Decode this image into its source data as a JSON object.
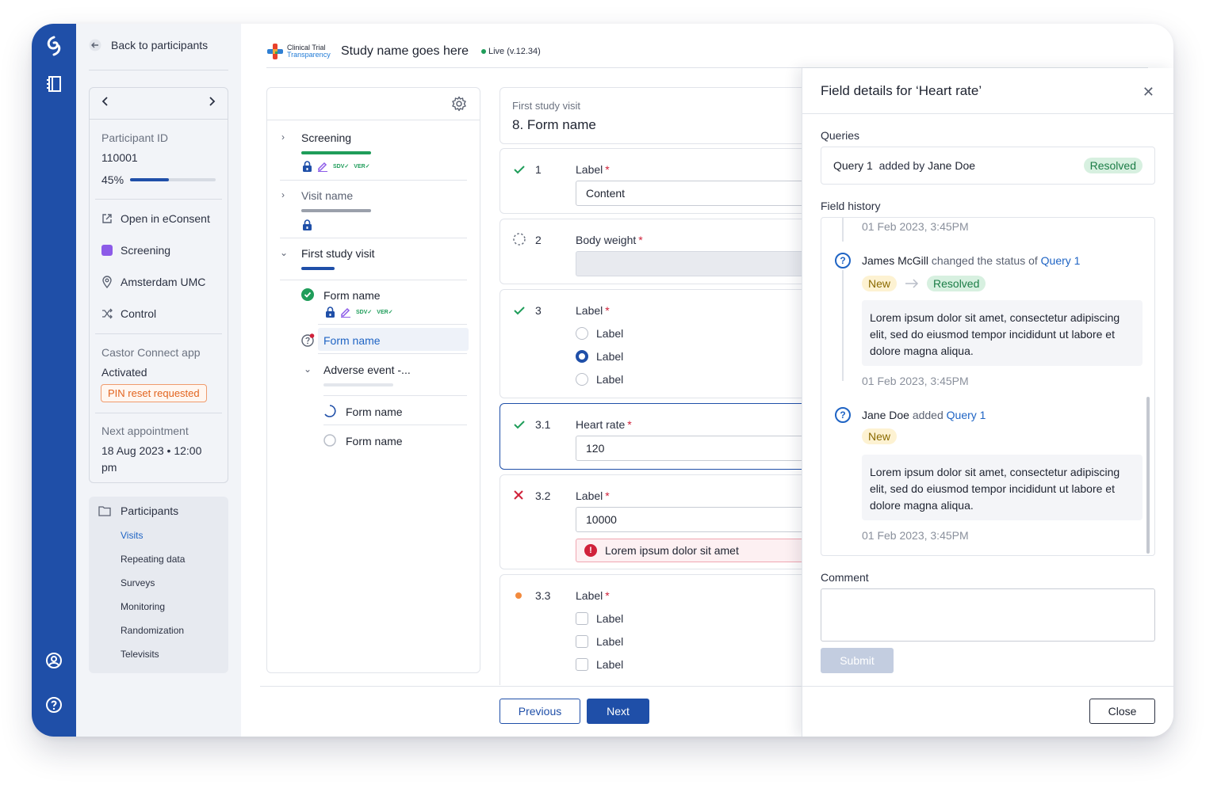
{
  "sidebar": {
    "back_label": "Back to participants",
    "participant_id_label": "Participant ID",
    "participant_id": "110001",
    "progress_text": "45%",
    "progress": 0.45,
    "links": [
      "Open in eConsent",
      "Screening",
      "Amsterdam UMC",
      "Control"
    ],
    "screening_color": "#8c5be8",
    "connect_label": "Castor Connect app",
    "connect_status": "Activated",
    "pin_badge": "PIN reset requested",
    "next_label": "Next appointment",
    "next_value_1": "18 Aug 2023 • 12:00",
    "next_value_2": "pm",
    "nav_head": "Participants",
    "nav_items": [
      "Visits",
      "Repeating data",
      "Surveys",
      "Monitoring",
      "Randomization",
      "Televisits"
    ]
  },
  "topbar": {
    "logo_line1": "Clinical Trial",
    "logo_line2": "Transparency",
    "study_name": "Study name goes here",
    "live": "Live (v.12.34)"
  },
  "tree": {
    "screening": "Screening",
    "visit_name": "Visit name",
    "first_visit": "First study visit",
    "form1": "Form name",
    "form2": "Form name",
    "adverse": "Adverse event -...",
    "form3": "Form name",
    "form4": "Form name",
    "sdv": "SDV",
    "ver": "VER",
    "screening_progress": 1.0,
    "visit_progress": 1.0,
    "first_visit_progress": 0.2,
    "adverse_progress": 0.0
  },
  "form": {
    "visit": "First study visit",
    "title": "8. Form name",
    "q1": {
      "num": "1",
      "label": "Label",
      "value": "Content"
    },
    "q2": {
      "num": "2",
      "label": "Body weight"
    },
    "q3": {
      "num": "3",
      "label": "Label",
      "options": [
        "Label",
        "Label",
        "Label"
      ]
    },
    "q31": {
      "num": "3.1",
      "label": "Heart rate",
      "value": "120"
    },
    "q32": {
      "num": "3.2",
      "label": "Label",
      "value": "10000",
      "error": "Lorem ipsum dolor sit amet"
    },
    "q33": {
      "num": "3.3",
      "label": "Label",
      "options": [
        "Label",
        "Label",
        "Label"
      ]
    },
    "req": "*",
    "prev": "Previous",
    "next": "Next"
  },
  "panel": {
    "title": "Field details for ‘Heart rate’",
    "queries_label": "Queries",
    "query_name": "Query 1",
    "query_added": "added by",
    "query_author": "Jane Doe",
    "query_status": "Resolved",
    "history_label": "Field history",
    "ts": "01 Feb 2023, 3:45PM",
    "e1_name": "James McGill",
    "e1_action": "changed the status of",
    "e1_query": "Query 1",
    "e1_from": "New",
    "e1_to": "Resolved",
    "e1_msg": "Lorem ipsum dolor sit amet, consectetur adipiscing elit, sed do eiusmod tempor incididunt ut labore et dolore magna aliqua.",
    "e2_name": "Jane Doe",
    "e2_action": "added",
    "e2_query": "Query 1",
    "e2_status": "New",
    "e2_msg": "Lorem ipsum dolor sit amet, consectetur adipiscing elit, sed do eiusmod tempor incididunt ut labore et dolore magna aliqua.",
    "comment_label": "Comment",
    "submit": "Submit",
    "close": "Close"
  },
  "colors": {
    "brand": "#1f4fa8",
    "success": "#1f9d5a",
    "error": "#d0213a",
    "warning": "#f28a3d"
  }
}
